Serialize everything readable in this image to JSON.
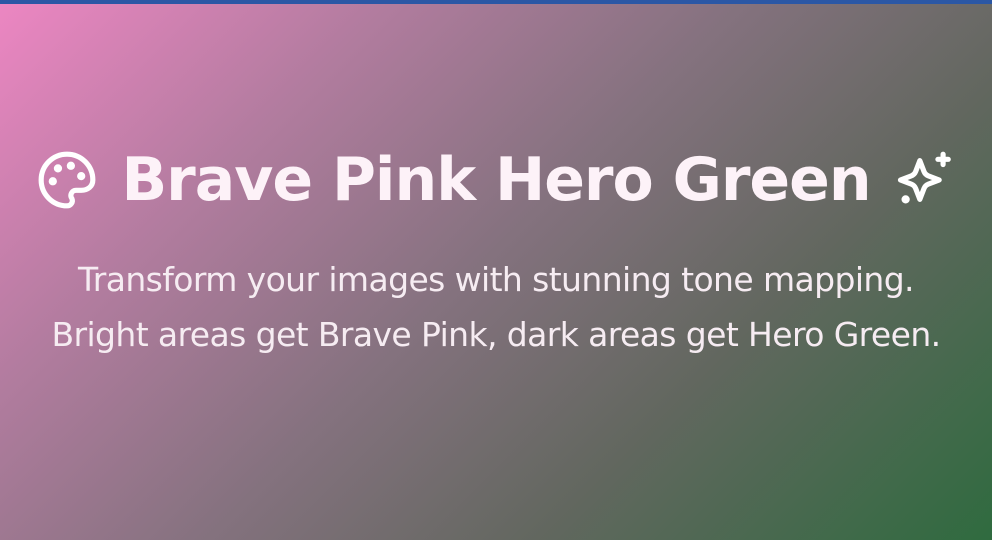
{
  "colors": {
    "top_border": "#2b57a5",
    "gradient_start": "#ec86c2",
    "gradient_end": "#2f6b3f",
    "text": "#ffffff"
  },
  "hero": {
    "title": "Brave Pink Hero Green",
    "leading_icon": "palette-icon",
    "trailing_icon": "sparkles-icon",
    "subtitle": "Transform your images with stunning tone mapping. Bright areas get Brave Pink, dark areas get Hero Green."
  }
}
